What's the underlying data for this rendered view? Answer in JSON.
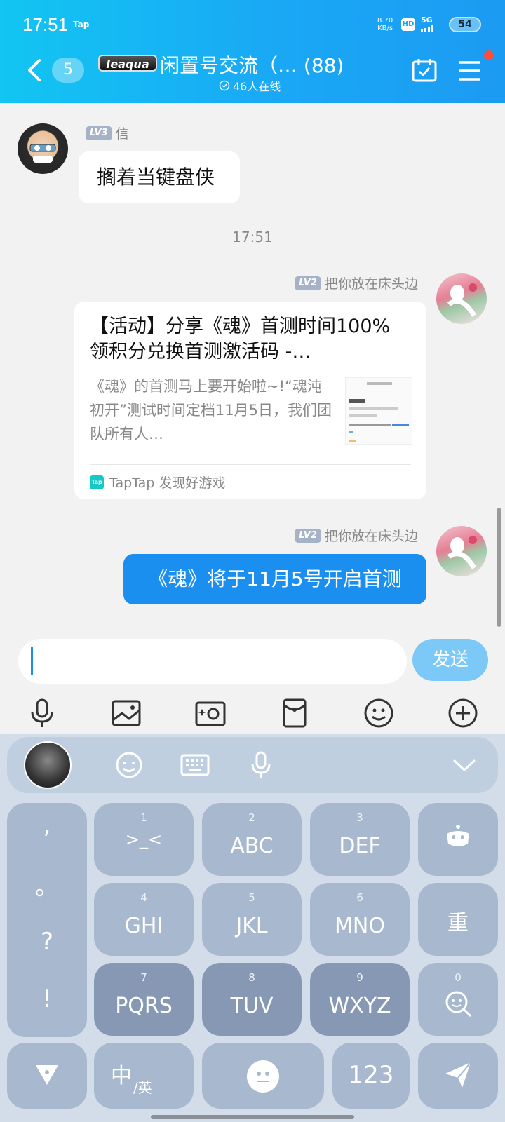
{
  "status_bar": {
    "time": "17:51",
    "tap_label": "Tap",
    "net_speed": "8.70",
    "net_unit": "KB/s",
    "hd": "HD",
    "network": "5G",
    "battery": "54"
  },
  "header": {
    "unread_count": "5",
    "group_logo_text": "Ieaqua",
    "title": "闲置号交流（…  (88)",
    "online": "46人在线"
  },
  "messages": {
    "m1": {
      "level": "LV3",
      "nickname": "信",
      "text": "搁着当键盘侠"
    },
    "timestamp": "17:51",
    "m2": {
      "level": "LV2",
      "nickname": "把你放在床头边",
      "card_title": "【活动】分享《魂》首测时间100%领积分兑换首测激活码 -…",
      "card_desc": "《魂》的首测马上要开始啦~!“魂沌初开”测试时间定档11月5日，我们团队所有人…",
      "card_source": "TapTap 发现好游戏",
      "source_logo": "Tap"
    },
    "m3": {
      "level": "LV2",
      "nickname": "把你放在床头边",
      "text": "《魂》将于11月5号开启首测"
    }
  },
  "composer": {
    "placeholder": "",
    "send_label": "发送"
  },
  "toolbar_icons": [
    "mic-icon",
    "image-icon",
    "camera-icon",
    "red-packet-icon",
    "emoji-icon",
    "plus-icon"
  ],
  "keyboard": {
    "punct": [
      ",",
      "。",
      "?",
      "!"
    ],
    "keys": [
      {
        "num": "1",
        "label": ">_<"
      },
      {
        "num": "2",
        "label": "ABC"
      },
      {
        "num": "3",
        "label": "DEF"
      },
      {
        "num": "4",
        "label": "GHI"
      },
      {
        "num": "5",
        "label": "JKL"
      },
      {
        "num": "6",
        "label": "MNO"
      },
      {
        "num": "7",
        "label": "PQRS"
      },
      {
        "num": "8",
        "label": "TUV"
      },
      {
        "num": "9",
        "label": "WXYZ"
      }
    ],
    "reset": "重",
    "search_num": "0",
    "lang": "中",
    "lang_sub": "/英",
    "num_key": "123"
  },
  "colors": {
    "header_start": "#12c5f2",
    "header_end": "#1b9bf2",
    "bubble_self": "#1b8ff0",
    "send_button": "#7cc8f6",
    "keyboard_bg": "#d3dde9"
  }
}
